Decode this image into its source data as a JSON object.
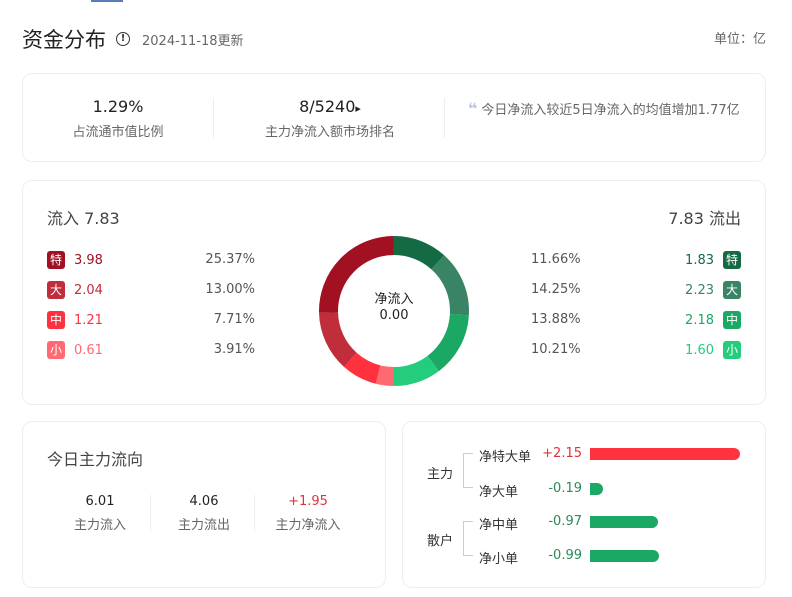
{
  "header": {
    "title": "资金分布",
    "updated": "2024-11-18更新",
    "unit": "单位：亿",
    "info_icon": "!"
  },
  "summary": {
    "ratio_value": "1.29%",
    "ratio_label": "占流通市值比例",
    "rank_value": "8/5240",
    "rank_arrow": "▸",
    "rank_label": "主力净流入额市场排名",
    "quote_mark": "❝",
    "note": "今日净流入较近5日净流入的均值增加1.77亿"
  },
  "distribution": {
    "inflow_label": "流入 7.83",
    "outflow_label": "7.83 流出",
    "center_label": "净流入",
    "center_value": "0.00",
    "inflow": [
      {
        "tag": "特",
        "value": "3.98",
        "pct": "25.37%",
        "color": "#a11122"
      },
      {
        "tag": "大",
        "value": "2.04",
        "pct": "13.00%",
        "color": "#c02d3b"
      },
      {
        "tag": "中",
        "value": "1.21",
        "pct": "7.71%",
        "color": "#ff313f"
      },
      {
        "tag": "小",
        "value": "0.61",
        "pct": "3.91%",
        "color": "#ff6a72"
      }
    ],
    "outflow": [
      {
        "tag": "特",
        "value": "1.83",
        "pct": "11.66%",
        "color": "#146b43"
      },
      {
        "tag": "大",
        "value": "2.23",
        "pct": "14.25%",
        "color": "#3a8466"
      },
      {
        "tag": "中",
        "value": "2.18",
        "pct": "13.88%",
        "color": "#1aa864"
      },
      {
        "tag": "小",
        "value": "1.60",
        "pct": "10.21%",
        "color": "#23cd7b"
      }
    ]
  },
  "main_flow": {
    "title": "今日主力流向",
    "items": [
      {
        "value": "6.01",
        "label": "主力流入"
      },
      {
        "value": "4.06",
        "label": "主力流出"
      },
      {
        "value": "+1.95",
        "label": "主力净流入"
      }
    ]
  },
  "net_bars": {
    "groups": [
      "主力",
      "散户"
    ],
    "max": 2.15,
    "items": [
      {
        "label": "净特大单",
        "value": "+2.15",
        "num": 2.15
      },
      {
        "label": "净大单",
        "value": "-0.19",
        "num": -0.19
      },
      {
        "label": "净中单",
        "value": "-0.97",
        "num": -0.97
      },
      {
        "label": "净小单",
        "value": "-0.99",
        "num": -0.99
      }
    ],
    "pos_color": "#ff333f",
    "neg_color": "#1aa864"
  }
}
